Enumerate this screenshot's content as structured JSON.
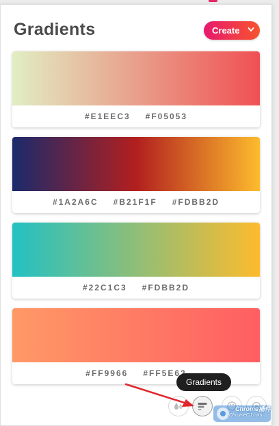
{
  "header": {
    "title": "Gradients",
    "create_label": "Create"
  },
  "gradients": [
    {
      "colors": [
        "#E1EEC3",
        "#F05053"
      ]
    },
    {
      "colors": [
        "#1A2A6C",
        "#B21F1F",
        "#FDBB2D"
      ]
    },
    {
      "colors": [
        "#22C1C3",
        "#FDBB2D"
      ]
    },
    {
      "colors": [
        "#FF9966",
        "#FF5E62"
      ]
    }
  ],
  "toolbar": {
    "active_tooltip": "Gradients",
    "icons": [
      "drops-icon",
      "gradients-icon",
      "palette-icon",
      "settings-icon"
    ]
  },
  "annotation": {
    "arrow_color": "#e0262c"
  },
  "watermark": {
    "line1": "Chrome插件",
    "line2": "ChromeCJ.com"
  },
  "colors": {
    "accent_start": "#e8196f",
    "accent_end": "#f7542d",
    "title": "#4a4a4a",
    "codes": "#6b6b6b"
  }
}
